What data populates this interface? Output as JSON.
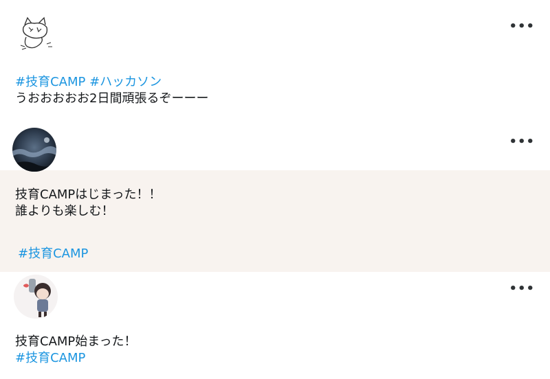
{
  "tweets": [
    {
      "avatar": "cat-doodle-avatar",
      "hashtags": [
        "#技育CAMP",
        "#ハッカソン"
      ],
      "body": "うおおおおお2日間頑張るぞーーー"
    },
    {
      "avatar": "night-sky-photo-avatar",
      "line1": "技育CAMPはじまった！！",
      "line2": "誰よりも楽しむ！",
      "hashtag": "#技育CAMP"
    },
    {
      "avatar": "illustrated-girl-avatar",
      "line1": "技育CAMP始まった！",
      "hashtag": "#技育CAMP"
    }
  ],
  "more_label": "•••",
  "colors": {
    "hashtag": "#1b95e0",
    "text": "#14171a",
    "highlight_bg": "#f8f3ef"
  }
}
